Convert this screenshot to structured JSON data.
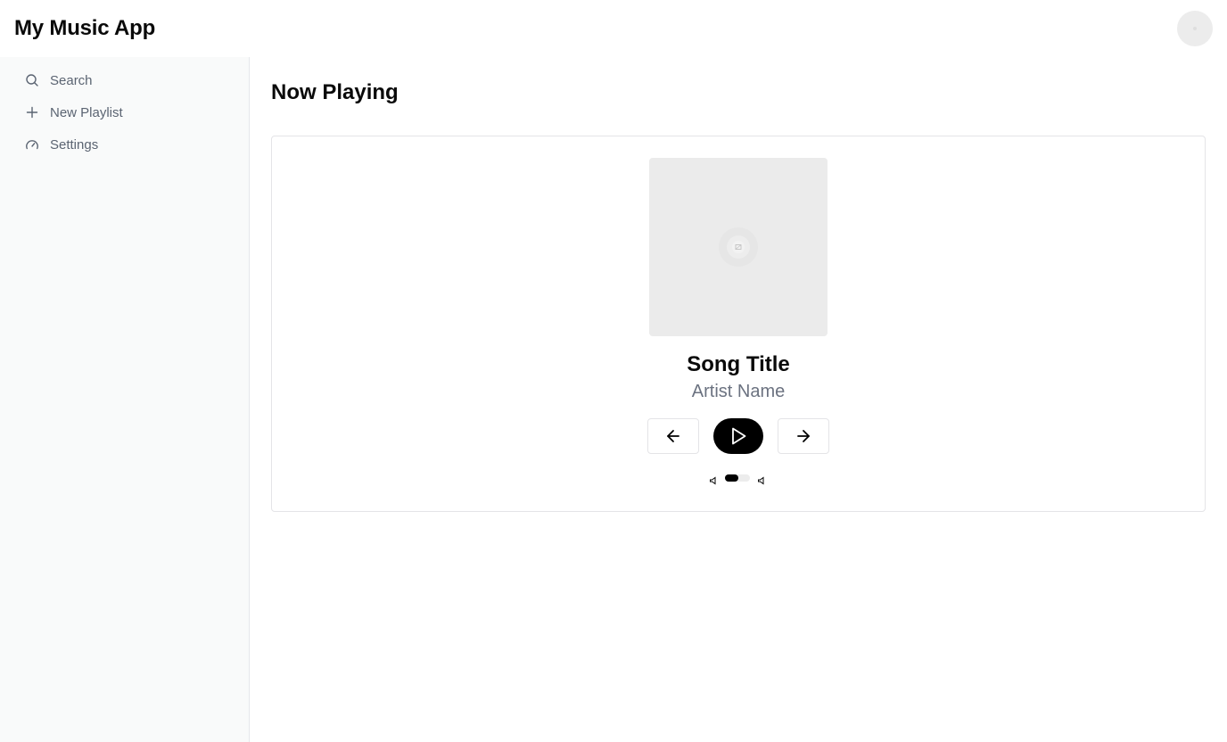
{
  "app": {
    "title": "My Music App"
  },
  "sidebar": {
    "items": [
      {
        "label": "Search",
        "icon": "search-icon"
      },
      {
        "label": "New Playlist",
        "icon": "plus-icon"
      },
      {
        "label": "Settings",
        "icon": "gauge-icon"
      }
    ]
  },
  "main": {
    "title": "Now Playing",
    "player": {
      "song_title": "Song Title",
      "artist_name": "Artist Name",
      "volume": 0.55
    }
  },
  "colors": {
    "accent": "#000000",
    "sidebar_bg": "#f9fafa",
    "muted_text": "#6b7280",
    "placeholder_bg": "#ebebeb"
  }
}
